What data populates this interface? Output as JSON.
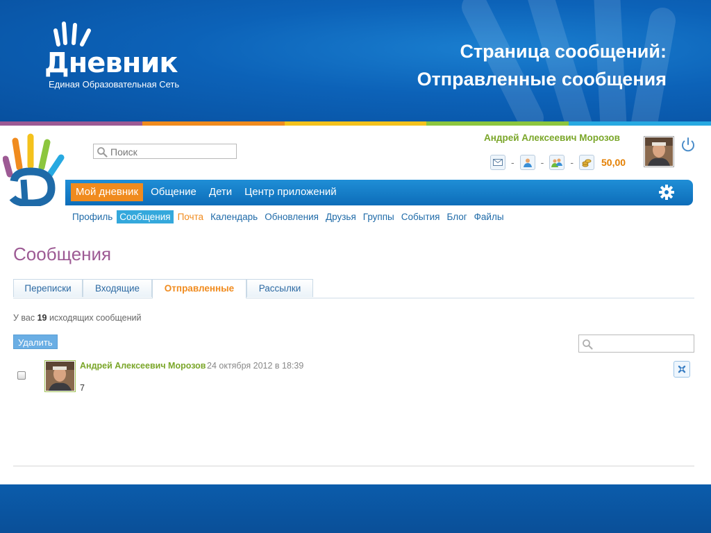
{
  "slide": {
    "logo_word": "Дневник",
    "logo_sub": "Единая Образовательная Сеть",
    "title_line1": "Страница сообщений:",
    "title_line2": "Отправленные сообщения",
    "rainbow_colors": [
      "#f08b1e",
      "#e4572e",
      "#f4c21c",
      "#8cc63e",
      "#27a9e1",
      "#9d5a94"
    ]
  },
  "header": {
    "search": {
      "placeholder": "Поиск"
    },
    "user_name": "Андрей Алексеевич Морозов",
    "coins": "50,00",
    "separator": "-",
    "toolbar_icons": [
      "mail-icon",
      "user-icon",
      "friends-icon",
      "coins-icon"
    ]
  },
  "nav": {
    "items": [
      {
        "label": "Мой дневник",
        "active": true
      },
      {
        "label": "Общение"
      },
      {
        "label": "Дети"
      },
      {
        "label": "Центр приложений"
      }
    ]
  },
  "subnav": {
    "items": [
      {
        "label": "Профиль"
      },
      {
        "label": "Сообщения",
        "active": true
      },
      {
        "label": "Почта"
      },
      {
        "label": "Календарь"
      },
      {
        "label": "Обновления"
      },
      {
        "label": "Друзья"
      },
      {
        "label": "Группы"
      },
      {
        "label": "События"
      },
      {
        "label": "Блог"
      },
      {
        "label": "Файлы"
      }
    ]
  },
  "main": {
    "title": "Сообщения",
    "tabs": [
      {
        "label": "Переписки"
      },
      {
        "label": "Входящие"
      },
      {
        "label": "Отправленные",
        "active": true
      },
      {
        "label": "Рассылки"
      }
    ],
    "count_prefix": "У вас",
    "count_value": "19",
    "count_suffix": "исходящих сообщений",
    "delete_label": "Удалить",
    "messages": [
      {
        "author": "Андрей Алексеевич Морозов",
        "date": "24 октября 2012 в 18:39",
        "text": "7"
      }
    ]
  },
  "colors": {
    "accent_orange": "#f08b1e",
    "brand_blue": "#1e6aa8",
    "green_name": "#7aa629",
    "title_purple": "#9d5a94"
  }
}
